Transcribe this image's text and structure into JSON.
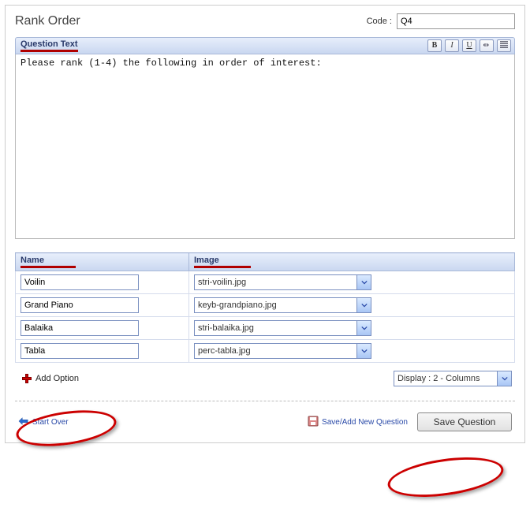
{
  "header": {
    "title": "Rank Order",
    "code_label": "Code :",
    "code_value": "Q4"
  },
  "section": {
    "label": "Question Text",
    "toolbar": {
      "bold": "B",
      "italic": "I",
      "underline": "U"
    }
  },
  "question_text": "Please rank (1-4) the following in order of interest:",
  "columns": {
    "name": "Name",
    "image": "Image"
  },
  "options": [
    {
      "name": "Voilin",
      "image": "stri-voilin.jpg"
    },
    {
      "name": "Grand Piano",
      "image": "keyb-grandpiano.jpg"
    },
    {
      "name": "Balaika",
      "image": "stri-balaika.jpg"
    },
    {
      "name": "Tabla",
      "image": "perc-tabla.jpg"
    }
  ],
  "add_option_label": "Add Option",
  "display_dropdown": "Display : 2 - Columns",
  "footer": {
    "start_over": "Start Over",
    "save_add": "Save/Add New Question",
    "save_button": "Save Question"
  }
}
